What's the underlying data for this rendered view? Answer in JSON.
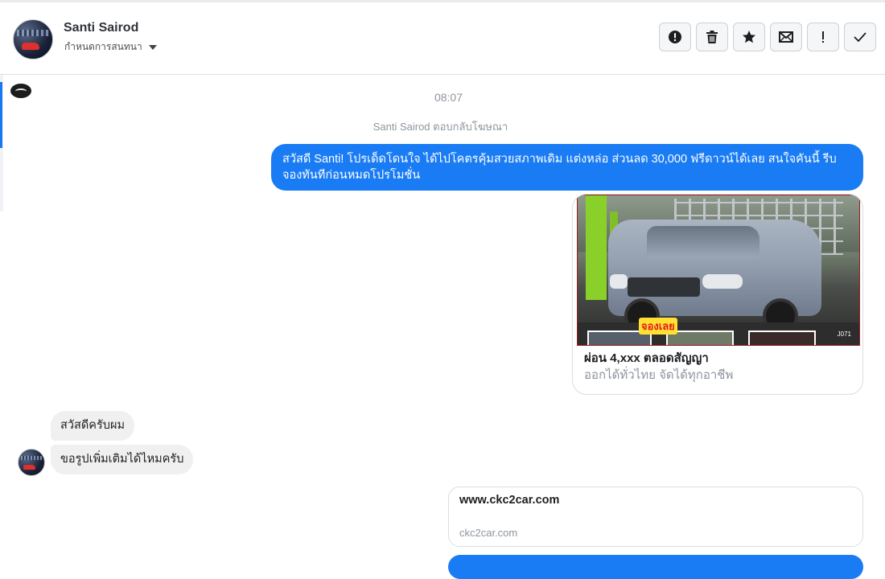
{
  "header": {
    "contact_name": "Santi Sairod",
    "contact_sub": "กำหนดการสนทนา",
    "actions": [
      {
        "name": "alert-button",
        "icon": "exclamation-circle-icon"
      },
      {
        "name": "delete-button",
        "icon": "trash-icon"
      },
      {
        "name": "star-button",
        "icon": "star-icon"
      },
      {
        "name": "mark-unread-button",
        "icon": "envelope-icon"
      },
      {
        "name": "important-button",
        "icon": "exclamation-icon"
      },
      {
        "name": "done-button",
        "icon": "check-icon"
      }
    ]
  },
  "conversation": {
    "timestamp": "08:07",
    "context_line": "Santi Sairod ตอบกลับโฆษณา",
    "outgoing_message": "สวัสดี Santi! โปรเด็ดโดนใจ ได้ไปโคตรคุ้มสวยสภาพเดิม แต่งหล่อ  ส่วนลด 30,000 ฟรีดาวน์ได้เลย  สนใจคันนี้ รีบจองทันทีก่อนหมดโปรโมชั่น",
    "ad_card": {
      "image_badge": "จองเลย",
      "image_code": "J071",
      "title": "ผ่อน 4,xxx ตลอดสัญญา",
      "subtitle": "ออกได้ทั่วไทย จัดได้ทุกอาชีพ"
    },
    "incoming_messages": [
      "สวัสดีครับผม",
      "ขอรูปเพิ่มเติมได้ไหมครับ"
    ],
    "link_card": {
      "title": "www.ckc2car.com",
      "domain": "ckc2car.com"
    }
  },
  "colors": {
    "accent": "#1a7cf5",
    "incoming_bubble": "#f1f0f0",
    "muted_text": "#90949c"
  }
}
